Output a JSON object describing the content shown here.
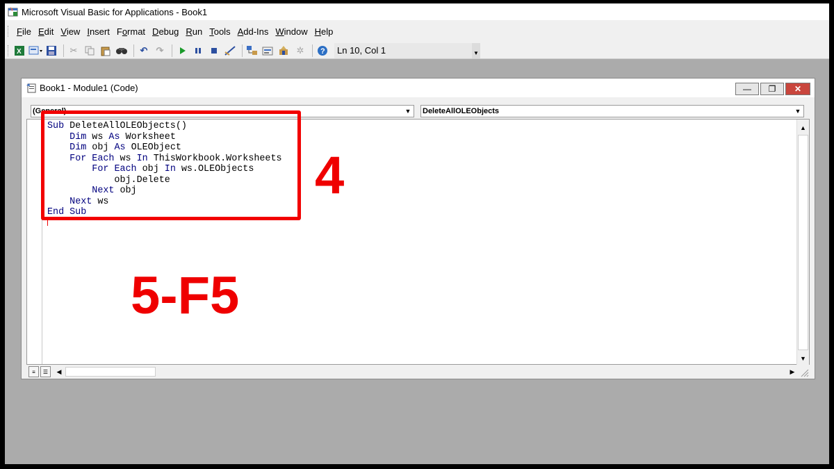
{
  "app": {
    "title": "Microsoft Visual Basic for Applications - Book1"
  },
  "menu": [
    {
      "ul": "F",
      "rest": "ile"
    },
    {
      "ul": "E",
      "rest": "dit"
    },
    {
      "ul": "V",
      "rest": "iew"
    },
    {
      "ul": "I",
      "rest": "nsert"
    },
    {
      "ul": "F",
      "rest": "ormat",
      "pre": "F",
      "prefix": true
    },
    {
      "ul": "D",
      "rest": "ebug"
    },
    {
      "ul": "R",
      "rest": "un"
    },
    {
      "ul": "T",
      "rest": "ools"
    },
    {
      "ul": "A",
      "rest": "dd-Ins"
    },
    {
      "ul": "W",
      "rest": "indow"
    },
    {
      "ul": "H",
      "rest": "elp"
    }
  ],
  "toolbar": {
    "status": "Ln 10, Col 1",
    "icons": [
      "excel-icon",
      "insert-userform-icon",
      "save-icon",
      "cut-icon",
      "copy-icon",
      "paste-icon",
      "find-icon",
      "undo-icon",
      "redo-icon",
      "run-icon",
      "break-icon",
      "reset-icon",
      "design-mode-icon",
      "project-explorer-icon",
      "properties-icon",
      "object-browser-icon",
      "toolbox-icon",
      "help-icon"
    ]
  },
  "code_window": {
    "title": "Book1 - Module1 (Code)",
    "object_dropdown": "(General)",
    "procedure_dropdown": "DeleteAllOLEObjects",
    "code_lines": [
      [
        {
          "k": "Sub"
        },
        {
          "t": " DeleteAllOLEObjects()"
        }
      ],
      [
        {
          "t": "    "
        },
        {
          "k": "Dim"
        },
        {
          "t": " ws "
        },
        {
          "k": "As"
        },
        {
          "t": " Worksheet"
        }
      ],
      [
        {
          "t": "    "
        },
        {
          "k": "Dim"
        },
        {
          "t": " obj "
        },
        {
          "k": "As"
        },
        {
          "t": " OLEObject"
        }
      ],
      [
        {
          "t": "    "
        },
        {
          "k": "For Each"
        },
        {
          "t": " ws "
        },
        {
          "k": "In"
        },
        {
          "t": " ThisWorkbook.Worksheets"
        }
      ],
      [
        {
          "t": "        "
        },
        {
          "k": "For Each"
        },
        {
          "t": " obj "
        },
        {
          "k": "In"
        },
        {
          "t": " ws.OLEObjects"
        }
      ],
      [
        {
          "t": "            obj.Delete"
        }
      ],
      [
        {
          "t": "        "
        },
        {
          "k": "Next"
        },
        {
          "t": " obj"
        }
      ],
      [
        {
          "t": "    "
        },
        {
          "k": "Next"
        },
        {
          "t": " ws"
        }
      ],
      [
        {
          "k": "End Sub"
        }
      ]
    ]
  },
  "annotations": {
    "step4": "4",
    "step5": "5-F5"
  },
  "colors": {
    "keyword": "#00007f",
    "annotation": "#ef0000"
  }
}
